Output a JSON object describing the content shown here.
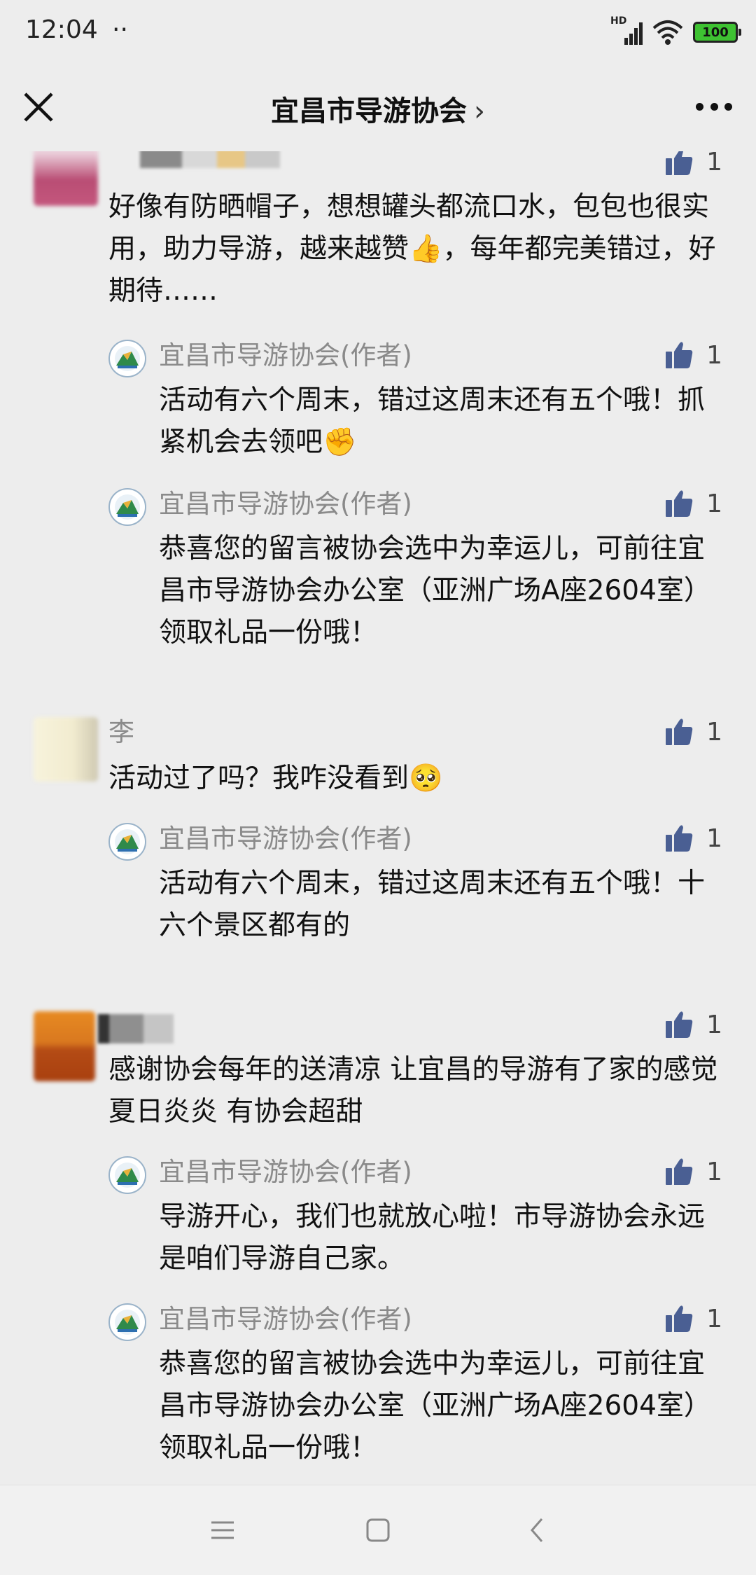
{
  "status": {
    "time": "12:04",
    "dots": "··",
    "network": "HD",
    "battery": "100"
  },
  "header": {
    "title": "宜昌市导游协会",
    "chevron": "›"
  },
  "comments": [
    {
      "text": "好像有防晒帽子，想想罐头都流口水，包包也很实用，助力导游，越来越赞👍，每年都完美错过，好期待……",
      "likes": "1",
      "replies": [
        {
          "author": "宜昌市导游协会(作者)",
          "text": "活动有六个周末，错过这周末还有五个哦！抓紧机会去领吧✊",
          "likes": "1"
        },
        {
          "author": "宜昌市导游协会(作者)",
          "text": "恭喜您的留言被协会选中为幸运儿，可前往宜昌市导游协会办公室（亚洲广场A座2604室）领取礼品一份哦！",
          "likes": "1"
        }
      ]
    },
    {
      "name": "李",
      "text": "活动过了吗？我咋没看到🥺",
      "likes": "1",
      "replies": [
        {
          "author": "宜昌市导游协会(作者)",
          "text": "活动有六个周末，错过这周末还有五个哦！十六个景区都有的",
          "likes": "1"
        }
      ]
    },
    {
      "text": "感谢协会每年的送清凉 让宜昌的导游有了家的感觉 夏日炎炎 有协会超甜",
      "likes": "1",
      "replies": [
        {
          "author": "宜昌市导游协会(作者)",
          "text": "导游开心，我们也就放心啦！市导游协会永远是咱们导游自己家。",
          "likes": "1"
        },
        {
          "author": "宜昌市导游协会(作者)",
          "text": "恭喜您的留言被协会选中为幸运儿，可前往宜昌市导游协会办公室（亚洲广场A座2604室）领取礼品一份哦！",
          "likes": "1"
        }
      ]
    }
  ],
  "icons": {
    "close": "close-icon",
    "more": "more-icon",
    "like": "thumbs-up-icon",
    "logo": "association-logo-icon",
    "nav_menu": "menu-icon",
    "nav_home": "home-square-icon",
    "nav_back": "back-chevron-icon"
  },
  "colors": {
    "background": "#ededed",
    "like_blue": "#4a5f93",
    "name_gray": "#8a8a8a",
    "battery_green": "#3ec232"
  }
}
